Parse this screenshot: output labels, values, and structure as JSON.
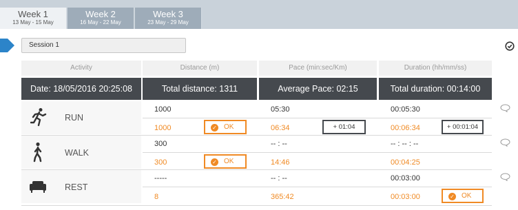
{
  "tabs": [
    {
      "title": "Week 1",
      "range": "13 May - 15 May",
      "active": true
    },
    {
      "title": "Week 2",
      "range": "16 May - 22 May",
      "active": false
    },
    {
      "title": "Week 3",
      "range": "23 May - 29 May",
      "active": false
    }
  ],
  "session": {
    "label": "Session 1"
  },
  "columns": {
    "activity": "Activity",
    "distance": "Distance (m)",
    "pace": "Pace (min:sec/Km)",
    "duration": "Duration (hh/mm/ss)"
  },
  "summary": {
    "date": "Date: 18/05/2016 20:25:08",
    "total_distance": "Total distance: 1311",
    "average_pace": "Average Pace:  02:15",
    "total_duration": "Total duration: 00:14:00"
  },
  "activities": [
    {
      "name": "RUN",
      "icon": "run-icon",
      "planned": {
        "distance": "1000",
        "pace": "05:30",
        "duration": "00:05:30"
      },
      "actual": {
        "distance": "1000",
        "pace": "06:34",
        "duration": "00:06:34"
      },
      "distance_badge": "OK",
      "pace_delta": "+ 01:04",
      "duration_delta": "+ 00:01:04"
    },
    {
      "name": "WALK",
      "icon": "walk-icon",
      "planned": {
        "distance": "300",
        "pace": "-- : --",
        "duration": "-- : -- : --"
      },
      "actual": {
        "distance": "300",
        "pace": "14:46",
        "duration": "00:04:25"
      },
      "distance_badge": "OK"
    },
    {
      "name": "REST",
      "icon": "sofa-icon",
      "planned": {
        "distance": "-----",
        "pace": "-- : --",
        "duration": "00:03:00"
      },
      "actual": {
        "distance": "8",
        "pace": "365:42",
        "duration": "00:03:00"
      },
      "duration_badge": "OK"
    }
  ],
  "colors": {
    "accent": "#f08a24",
    "dark": "#45494e",
    "blue": "#2c84c9"
  }
}
